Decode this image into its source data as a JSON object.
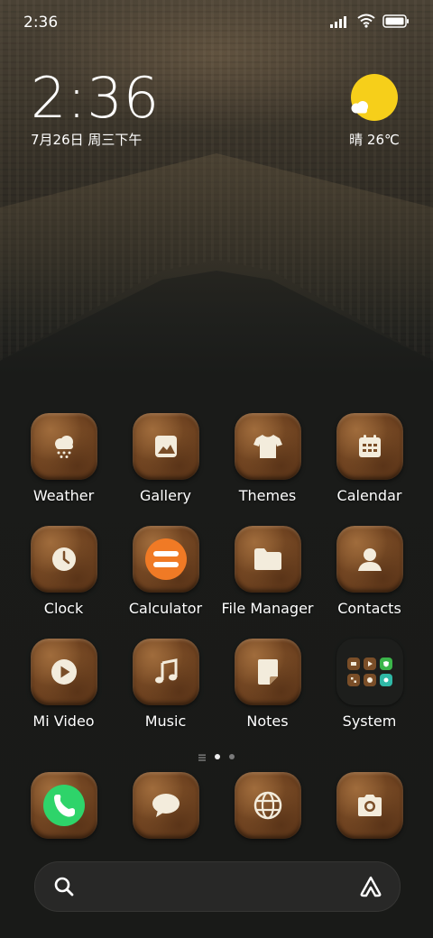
{
  "status_bar": {
    "time": "2:36",
    "icons": [
      "signal-icon",
      "wifi-icon",
      "battery-icon"
    ]
  },
  "clock_widget": {
    "time": "2:36",
    "date": "7月26日 周三下午"
  },
  "weather_widget": {
    "icon": "sunny-cloud-icon",
    "text": "晴 26℃",
    "sun_color": "#f6cf1a"
  },
  "apps": [
    {
      "label": "Weather",
      "icon": "weather-snow-cloud-icon"
    },
    {
      "label": "Gallery",
      "icon": "gallery-image-icon"
    },
    {
      "label": "Themes",
      "icon": "tshirt-icon"
    },
    {
      "label": "Calendar",
      "icon": "calendar-icon"
    },
    {
      "label": "Clock",
      "icon": "clock-icon"
    },
    {
      "label": "Calculator",
      "icon": "calculator-icon"
    },
    {
      "label": "File Manager",
      "icon": "folder-icon"
    },
    {
      "label": "Contacts",
      "icon": "contact-person-icon"
    },
    {
      "label": "Mi Video",
      "icon": "play-icon"
    },
    {
      "label": "Music",
      "icon": "music-note-icon"
    },
    {
      "label": "Notes",
      "icon": "notes-page-icon"
    },
    {
      "label": "System",
      "icon": "folder-grid-icon"
    }
  ],
  "page_indicator": {
    "pages": 2,
    "active": 1
  },
  "dock": [
    {
      "icon": "phone-icon"
    },
    {
      "icon": "message-bubble-icon"
    },
    {
      "icon": "browser-globe-icon"
    },
    {
      "icon": "camera-icon"
    }
  ],
  "search": {
    "left_icon": "search-icon",
    "right_icon": "assistant-icon"
  },
  "colors": {
    "tile_brown": "#8a5a2e",
    "calculator_orange": "#f07a25",
    "phone_green": "#2ed46a"
  }
}
